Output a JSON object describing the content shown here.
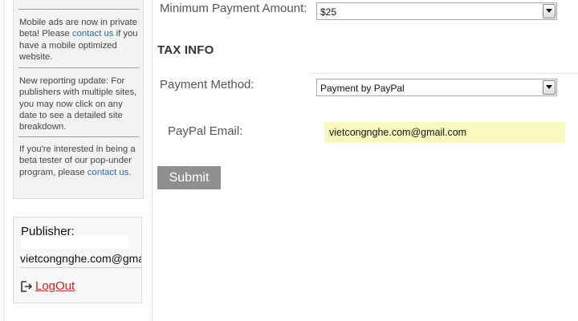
{
  "sidebar": {
    "news": [
      {
        "text_before": "Mobile ads are now in private beta! Please ",
        "link": "contact us",
        "text_after": " if you have a mobile optimized website."
      },
      {
        "text_before": "New reporting update: For publishers with multiple sites, you may now click on any date to see a detailed site breakdown.",
        "link": "",
        "text_after": ""
      },
      {
        "text_before": "If you're interested in being a beta tester of our pop-under program, please ",
        "link": "contact us",
        "text_after": "."
      }
    ],
    "publisher": {
      "title": "Publisher:",
      "email": "vietcongnghe.com@gmail.com",
      "logout_label": "LogOut"
    }
  },
  "form": {
    "minimum_payment": {
      "label": "Minimum Payment Amount:",
      "value": "$25"
    },
    "tax_info_heading": "TAX INFO",
    "payment_method": {
      "label": "Payment Method:",
      "value": "Payment by PayPal"
    },
    "paypal_email": {
      "label": "PayPal Email:",
      "value": "vietcongnghe.com@gmail.com"
    },
    "submit_label": "Submit"
  },
  "colors": {
    "link": "#2a6aa6",
    "logout": "#cc1f1f",
    "input_highlight": "#fafabf",
    "submit_bg": "#8f8f8f"
  },
  "icons": {
    "logout": "logout-icon",
    "dropdown": "chevron-down-icon"
  }
}
